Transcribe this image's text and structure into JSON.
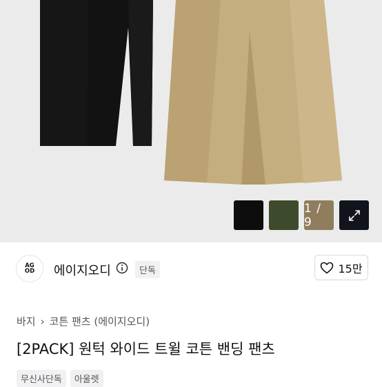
{
  "gallery": {
    "counter": "1 / 9",
    "swatches": [
      {
        "name": "black",
        "color": "#0d0d0d"
      },
      {
        "name": "olive",
        "color": "#3d4a2c"
      },
      {
        "name": "beige",
        "color": "#c6ae82"
      }
    ],
    "expand_icon": "expand-icon"
  },
  "brand": {
    "logo_text": "AG OD",
    "name": "에이지오디",
    "badge": "단독",
    "info_icon": "info-icon"
  },
  "like": {
    "icon": "heart-icon",
    "count": "15만"
  },
  "breadcrumb": {
    "category": "바지",
    "separator": "›",
    "subcategory": "코튼 팬츠 (에이지오디)"
  },
  "product": {
    "title": "[2PACK] 원턱 와이드 트윌 코튼 밴딩 팬츠"
  },
  "tags": [
    "무신사단독",
    "아울렛"
  ]
}
